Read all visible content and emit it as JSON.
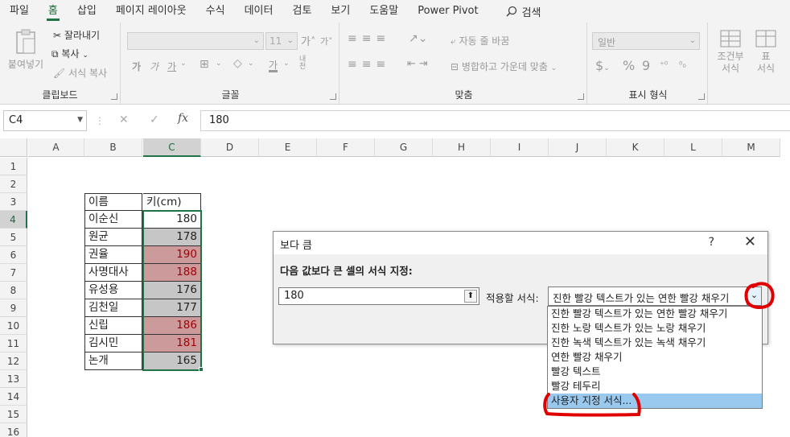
{
  "menu": {
    "tabs": [
      "파일",
      "홈",
      "삽입",
      "페이지 레이아웃",
      "수식",
      "데이터",
      "검토",
      "보기",
      "도움말",
      "Power Pivot"
    ],
    "active_tab": "홈",
    "search_label": "검색"
  },
  "ribbon": {
    "clipboard": {
      "paste": "붙여넣기",
      "cut": "잘라내기",
      "copy": "복사",
      "format_painter": "서식 복사",
      "label": "클립보드"
    },
    "font": {
      "size": "11",
      "grow": "가",
      "shrink": "가",
      "bold": "가",
      "italic": "가",
      "underline": "가",
      "font_color": "가",
      "phonetic": "내천",
      "label": "글꼴"
    },
    "alignment": {
      "wrap_text": "자동 줄 바꿈",
      "merge_center": "병합하고 가운데 맞춤",
      "label": "맞춤"
    },
    "number": {
      "format": "일반",
      "currency": "$",
      "percent": "%",
      "comma": "9",
      "label": "표시 형식"
    },
    "styles": {
      "conditional": "조건부\n서식",
      "table": "표\n서식"
    }
  },
  "formula_bar": {
    "name_box": "C4",
    "fx": "fx",
    "content": "180"
  },
  "grid": {
    "columns": [
      "A",
      "B",
      "C",
      "D",
      "E",
      "F",
      "G",
      "H",
      "I",
      "J",
      "K",
      "L",
      "M"
    ],
    "rows": [
      "1",
      "2",
      "3",
      "4",
      "5",
      "6",
      "7",
      "8",
      "9",
      "10",
      "11",
      "12",
      "13",
      "14",
      "15",
      "16"
    ],
    "selected_column": "C",
    "selected_row": "4",
    "table_header": [
      "이름",
      "키(cm)"
    ],
    "table_rows": [
      {
        "name": "이순신",
        "value": "180",
        "style": "selected"
      },
      {
        "name": "원균",
        "value": "178",
        "style": "gray"
      },
      {
        "name": "권율",
        "value": "190",
        "style": "red"
      },
      {
        "name": "사명대사",
        "value": "188",
        "style": "red"
      },
      {
        "name": "유성용",
        "value": "176",
        "style": "gray"
      },
      {
        "name": "김천일",
        "value": "177",
        "style": "gray"
      },
      {
        "name": "신립",
        "value": "186",
        "style": "red"
      },
      {
        "name": "김시민",
        "value": "181",
        "style": "red"
      },
      {
        "name": "논개",
        "value": "165",
        "style": "gray"
      }
    ]
  },
  "dialog": {
    "title": "보다 큼",
    "help": "?",
    "close": "✕",
    "prompt": "다음 값보다 큰 셀의 서식 지정:",
    "value": "180",
    "apply_label": "적용할 서식:",
    "selected_format": "진한 빨강 텍스트가 있는 연한 빨강 채우기",
    "options": [
      "진한 빨강 텍스트가 있는 연한 빨강 채우기",
      "진한 노랑 텍스트가 있는 노랑 채우기",
      "진한 녹색 텍스트가 있는 녹색 채우기",
      "연한 빨강 채우기",
      "빨강 텍스트",
      "빨강 테두리",
      "사용자 지정 서식..."
    ],
    "highlighted_option": "사용자 지정 서식..."
  },
  "colors": {
    "excel_green": "#217346",
    "gray_fill": "#c6c6c6",
    "red_fill": "#cc9a9a",
    "red_text": "#9c0006",
    "annotation_red": "#e00000",
    "highlight_blue": "#99c9ef"
  }
}
